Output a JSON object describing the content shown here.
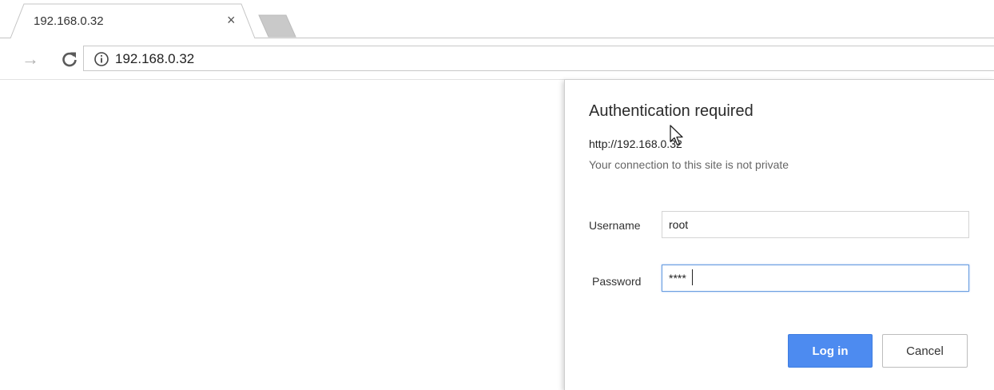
{
  "tab": {
    "title": "192.168.0.32",
    "close_glyph": "×"
  },
  "toolbar": {
    "forward_icon": "arrow-forward-icon",
    "reload_icon": "reload-icon",
    "info_icon": "info-icon",
    "url": "192.168.0.32"
  },
  "dialog": {
    "title": "Authentication required",
    "url": "http://192.168.0.32",
    "note": "Your connection to this site is not private",
    "username_label": "Username",
    "username_value": "root",
    "password_label": "Password",
    "password_value": "****",
    "login_label": "Log in",
    "cancel_label": "Cancel"
  },
  "colors": {
    "primary_button": "#4d8bf0",
    "focus_border": "#6a9ee0"
  }
}
